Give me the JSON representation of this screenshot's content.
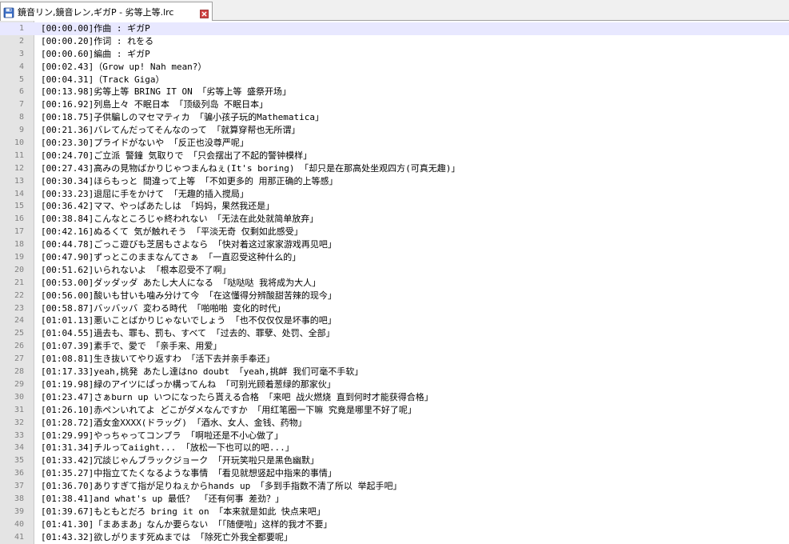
{
  "tab": {
    "title": "鏡音リン,鏡音レン,ギガP - 劣等上等.lrc",
    "icon": "save-disk-icon",
    "close_icon": "close-icon"
  },
  "colors": {
    "current_line": "#e8e8ff",
    "gutter": "#e4e4e4",
    "line_number": "#808080",
    "close_red": "#d04040"
  },
  "editor": {
    "current_line_index": 0,
    "lines": [
      {
        "n": "1",
        "text": "[00:00.00]作曲 : ギガP"
      },
      {
        "n": "2",
        "text": "[00:00.20]作词 : れをる"
      },
      {
        "n": "3",
        "text": "[00:00.60]編曲 : ギガP"
      },
      {
        "n": "4",
        "text": "[00:02.43]（Grow up! Nah mean?）"
      },
      {
        "n": "5",
        "text": "[00:04.31]（Track Giga）"
      },
      {
        "n": "6",
        "text": "[00:13.98]劣等上等 BRING IT ON 「劣等上等 盛祭开场」"
      },
      {
        "n": "7",
        "text": "[00:16.92]列島上々 不眠日本 「顶级列岛 不眠日本」"
      },
      {
        "n": "8",
        "text": "[00:18.75]子供騙しのマセマティカ 「骗小孩子玩的Mathematica」"
      },
      {
        "n": "9",
        "text": "[00:21.36]バレてんだってそんなのって 「就算穿帮也无所谓」"
      },
      {
        "n": "10",
        "text": "[00:23.30]プライドがないや 「反正也没尊严呢」"
      },
      {
        "n": "11",
        "text": "[00:24.70]ご立派 警鐘 気取りで 「只会摆出了不起的警钟模样」"
      },
      {
        "n": "12",
        "text": "[00:27.43]高みの見物ばかりじゃつまんねぇ(It's boring) 「却只是在那高处坐观四方(可真无趣)」"
      },
      {
        "n": "13",
        "text": "[00:30.34]ほらもっと 間違って上等 「不如更多的 用那正确的上等感」"
      },
      {
        "n": "14",
        "text": "[00:33.23]退屈に手をかけて 「无趣的插入搅局」"
      },
      {
        "n": "15",
        "text": "[00:36.42]ママ、やっぱあたしは 「妈妈，果然我还是」"
      },
      {
        "n": "16",
        "text": "[00:38.84]こんなところじゃ終われない 「无法在此处就简单放弃」"
      },
      {
        "n": "17",
        "text": "[00:42.16]ぬるくて 気が触れそう 「平淡无奇 仅剩如此感受」"
      },
      {
        "n": "18",
        "text": "[00:44.78]ごっこ遊びも芝居もさよなら 「快对着这过家家游戏再见吧」"
      },
      {
        "n": "19",
        "text": "[00:47.90]ずっとこのままなんてさぁ 「一直忍受这种什么的」"
      },
      {
        "n": "20",
        "text": "[00:51.62]いられないよ 「根本忍受不了啊」"
      },
      {
        "n": "21",
        "text": "[00:53.00]ダッダッダ あたし大人になる 「哒哒哒 我将成为大人」"
      },
      {
        "n": "22",
        "text": "[00:56.00]酸いも甘いも噛み分けて今 「在这懂得分辨酸甜苦辣的现今」"
      },
      {
        "n": "23",
        "text": "[00:58.87]バッバッバ 変わる時代 「啪啪啪 变化的时代」"
      },
      {
        "n": "24",
        "text": "[01:01.13]悪いことばかりじゃないでしょう 「也不仅仅仅是坏事的吧」"
      },
      {
        "n": "25",
        "text": "[01:04.55]過去も、罪も、罰も、すべて 「过去的、罪孽、处罚、全部」"
      },
      {
        "n": "26",
        "text": "[01:07.39]素手で、愛で 「亲手来、用爱」"
      },
      {
        "n": "27",
        "text": "[01:08.81]生き抜いてやり返すわ 「活下去并亲手奉还」"
      },
      {
        "n": "28",
        "text": "[01:17.33]yeah,挑発 あたし達はno doubt 「yeah,挑衅 我们可毫不手软」"
      },
      {
        "n": "29",
        "text": "[01:19.98]緑のアイツにぱっか構ってんね 「可别光顾着葱绿的那家伙」"
      },
      {
        "n": "30",
        "text": "[01:23.47]さぁburn up いつになったら貰える合格 「来吧 战火燃烧 直到何时才能获得合格」"
      },
      {
        "n": "31",
        "text": "[01:26.10]赤ペンいれてよ どこがダメなんですか 「用红笔圈一下嘛 究竟是哪里不好了呢」"
      },
      {
        "n": "32",
        "text": "[01:28.72]酒女金XXXX(ドラッグ) 「酒水、女人、金钱、药物」"
      },
      {
        "n": "33",
        "text": "[01:29.99]やっちゃってコンプラ 「啊啦还是不小心做了」"
      },
      {
        "n": "34",
        "text": "[01:31.34]チルってaiight... 「放松一下也可以的吧...」"
      },
      {
        "n": "35",
        "text": "[01:33.42]冗談じゃんブラックジョーク 「开玩笑啦只是黑色幽默」"
      },
      {
        "n": "36",
        "text": "[01:35.27]中指立てたくなるような事情 「看见就想竖起中指来的事情」"
      },
      {
        "n": "37",
        "text": "[01:36.70]ありすぎて指が足りねぇからhands up 「多到手指数不清了所以 举起手吧」"
      },
      {
        "n": "38",
        "text": "[01:38.41]and what's up 最低？ 「还有何事 差劲？」"
      },
      {
        "n": "39",
        "text": "[01:39.67]もともとだろ bring it on 「本来就是如此 快点来吧」"
      },
      {
        "n": "40",
        "text": "[01:41.30]「まあまあ」なんか要らない 「「随便啦」这样的我才不要」"
      },
      {
        "n": "41",
        "text": "[01:43.32]欲しがります死ぬまでは 「除死亡外我全都要呢」"
      }
    ]
  }
}
